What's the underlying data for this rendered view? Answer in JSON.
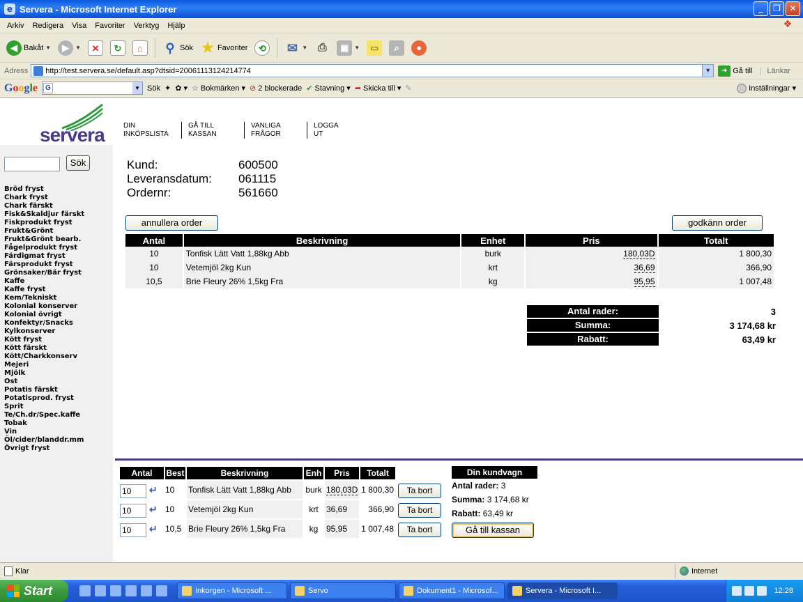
{
  "window": {
    "title": "Servera - Microsoft Internet Explorer"
  },
  "menu": [
    "Arkiv",
    "Redigera",
    "Visa",
    "Favoriter",
    "Verktyg",
    "Hjälp"
  ],
  "toolbar": {
    "back": "Bakåt",
    "search": "Sök",
    "favorites": "Favoriter"
  },
  "address": {
    "label": "Adress",
    "url": "http://test.servera.se/default.asp?dtsid=20061113124214774",
    "go": "Gå till",
    "links": "Länkar"
  },
  "googlebar": {
    "search": "Sök",
    "bookmarks": "Bokmärken",
    "blocked": "2 blockerade",
    "spelling": "Stavning",
    "sendto": "Skicka till",
    "settings": "Inställningar"
  },
  "site": {
    "logo": "servera",
    "nav": [
      [
        "DIN",
        "INKÖPSLISTA"
      ],
      [
        "GÅ TILL",
        "KASSAN"
      ],
      [
        "VANLIGA",
        "FRÅGOR"
      ],
      [
        "LOGGA",
        "UT"
      ]
    ],
    "search_button": "Sök",
    "categories": [
      "Bröd fryst",
      "Chark fryst",
      "Chark färskt",
      "Fisk&Skaldjur färskt",
      "Fiskprodukt fryst",
      "Frukt&Grönt",
      "Frukt&Grönt bearb.",
      "Fågelprodukt fryst",
      "Färdigmat fryst",
      "Färsprodukt fryst",
      "Grönsaker/Bär fryst",
      "Kaffe",
      "Kaffe fryst",
      "Kem/Tekniskt",
      "Kolonial konserver",
      "Kolonial övrigt",
      "Konfektyr/Snacks",
      "Kylkonserver",
      "Kött fryst",
      "Kött färskt",
      "Kött/Charkkonserv",
      "Mejeri",
      "Mjölk",
      "Ost",
      "Potatis färskt",
      "Potatisprod. fryst",
      "Sprit",
      "Te/Ch.dr/Spec.kaffe",
      "Tobak",
      "Vin",
      "Öl/cider/blanddr.mm",
      "Övrigt fryst"
    ]
  },
  "order": {
    "labels": {
      "kund": "Kund:",
      "leveransdatum": "Leveransdatum:",
      "ordernr": "Ordernr:"
    },
    "kund": "600500",
    "leveransdatum": "061115",
    "ordernr": "561660",
    "cancel_button": "annullera order",
    "approve_button": "godkänn order",
    "columns": [
      "Antal",
      "Beskrivning",
      "Enhet",
      "Pris",
      "Totalt"
    ],
    "rows": [
      {
        "antal": "10",
        "beskrivning": "Tonfisk Lätt Vatt 1,88kg Abb",
        "enhet": "burk",
        "pris": "180,03D",
        "totalt": "1 800,30"
      },
      {
        "antal": "10",
        "beskrivning": "Vetemjöl 2kg Kun",
        "enhet": "krt",
        "pris": "36,69",
        "totalt": "366,90"
      },
      {
        "antal": "10,5",
        "beskrivning": "Brie Fleury 26% 1,5kg Fra",
        "enhet": "kg",
        "pris": "95,95",
        "totalt": "1 007,48"
      }
    ],
    "summary": [
      {
        "label": "Antal rader:",
        "value": "3"
      },
      {
        "label": "Summa:",
        "value": "3 174,68 kr"
      },
      {
        "label": "Rabatt:",
        "value": "63,49 kr"
      }
    ]
  },
  "basket": {
    "columns": [
      "Antal",
      "Best",
      "Beskrivning",
      "Enh",
      "Pris",
      "Totalt"
    ],
    "rows": [
      {
        "antal": "10",
        "best": "10",
        "beskrivning": "Tonfisk Lätt Vatt 1,88kg Abb",
        "enh": "burk",
        "pris": "180,03D",
        "totalt": "1 800,30",
        "remove": "Ta bort"
      },
      {
        "antal": "10",
        "best": "10",
        "beskrivning": "Vetemjöl 2kg Kun",
        "enh": "krt",
        "pris": "36,69",
        "totalt": "366,90",
        "remove": "Ta bort"
      },
      {
        "antal": "10",
        "best": "10,5",
        "beskrivning": "Brie Fleury 26% 1,5kg Fra",
        "enh": "kg",
        "pris": "95,95",
        "totalt": "1 007,48",
        "remove": "Ta bort"
      }
    ]
  },
  "cart": {
    "title": "Din kundvagn",
    "rows_label": "Antal rader:",
    "rows_value": "3",
    "sum_label": "Summa:",
    "sum_value": "3 174,68 kr",
    "discount_label": "Rabatt:",
    "discount_value": "63,49 kr",
    "checkout_button": "Gå till kassan"
  },
  "status": {
    "text": "Klar",
    "zone": "Internet"
  },
  "taskbar": {
    "start": "Start",
    "tasks": [
      "Inkorgen - Microsoft ...",
      "Servo",
      "Dokument1 - Microsof...",
      "Servera - Microsoft I..."
    ],
    "clock": "12:28"
  }
}
